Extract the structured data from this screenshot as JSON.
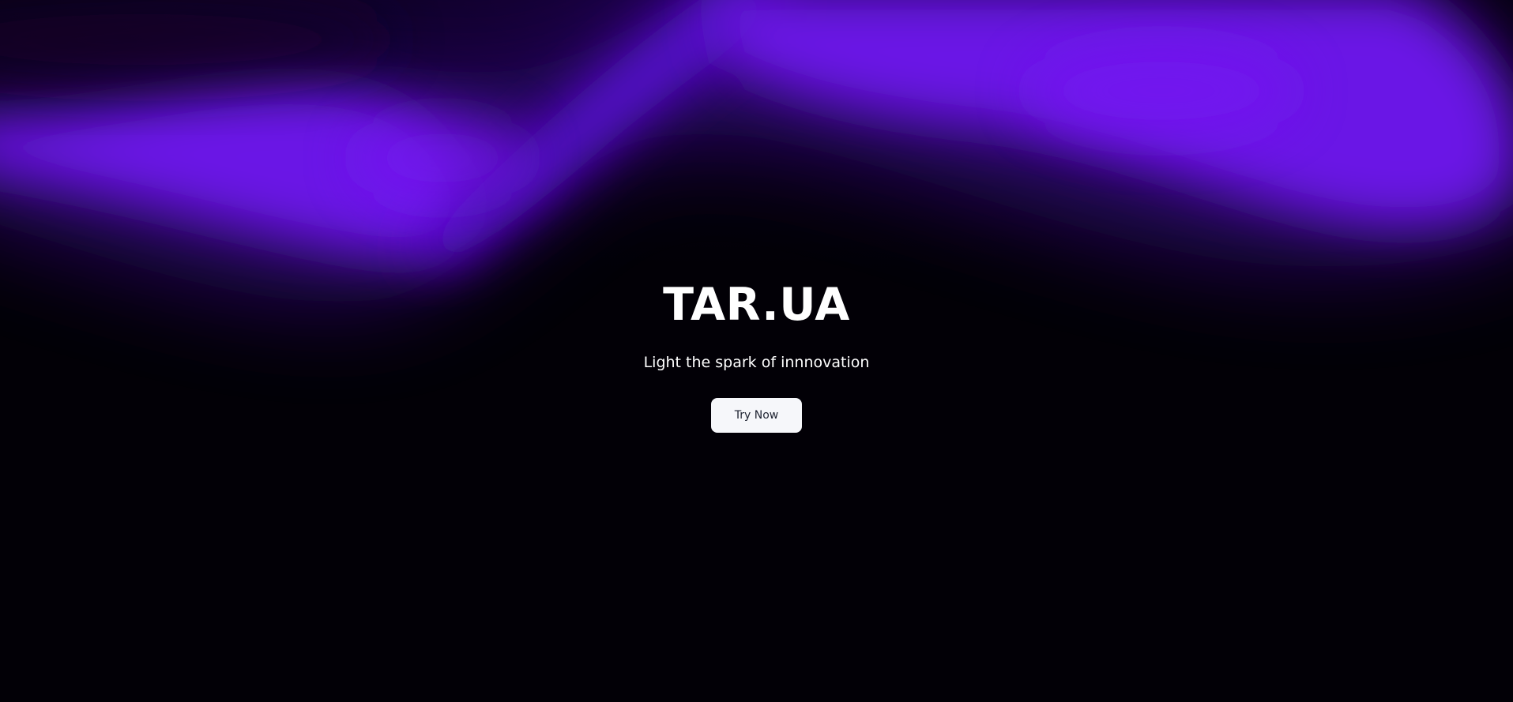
{
  "hero": {
    "brand": "TAR.UA",
    "tagline": "Light the spark of innnovation",
    "cta_label": "Try Now"
  },
  "colors": {
    "background": "#020006",
    "glow": "#6a14e6",
    "text": "#ffffff",
    "button_bg": "#f6f7fa",
    "button_text": "#1d2230"
  }
}
